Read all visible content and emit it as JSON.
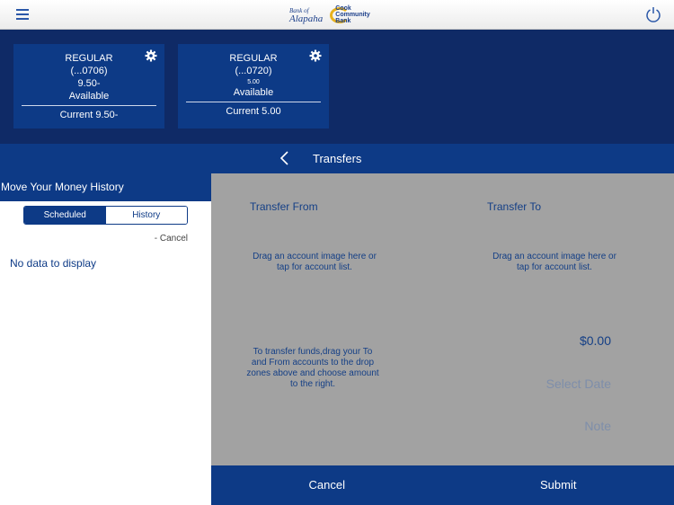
{
  "topbar": {
    "logo_bank_name": "Bank of Alapaha",
    "logo_bank_line1": "Bank of",
    "logo_bank_line2": "Alapaha",
    "logo_cook_line1": "Cook",
    "logo_cook_line2": "Community",
    "logo_cook_line3": "Bank"
  },
  "accounts": [
    {
      "name": "REGULAR",
      "number": "(...0706)",
      "available_value": "9.50-",
      "available_label": "Available",
      "current": "Current 9.50-"
    },
    {
      "name": "REGULAR",
      "number": "(...0720)",
      "available_value": "5.00",
      "available_label": "Available",
      "current": "Current 5.00"
    }
  ],
  "transfers_bar": {
    "title": "Transfers"
  },
  "history_panel": {
    "title": "Move Your Money History",
    "tabs": [
      "Scheduled",
      "History"
    ],
    "active_tab": "Scheduled",
    "cancel_link": "- Cancel",
    "empty_text": "No data to display"
  },
  "transfer_panel": {
    "from_label": "Transfer From",
    "to_label": "Transfer To",
    "from_drop_text": "Drag an account image here or tap for account list.",
    "to_drop_text": "Drag an account image here or tap for account list.",
    "instructions": "To transfer funds,drag your To and From accounts to the drop zones above and choose amount to the right.",
    "amount": "$0.00",
    "date_placeholder": "Select Date",
    "note_placeholder": "Note"
  },
  "buttons": {
    "cancel": "Cancel",
    "submit": "Submit"
  },
  "colors": {
    "primary": "#0d3a86",
    "dark_bg": "#0f2a66",
    "panel_gray": "#a2a2a2",
    "logo_gold": "#e8b21c"
  }
}
